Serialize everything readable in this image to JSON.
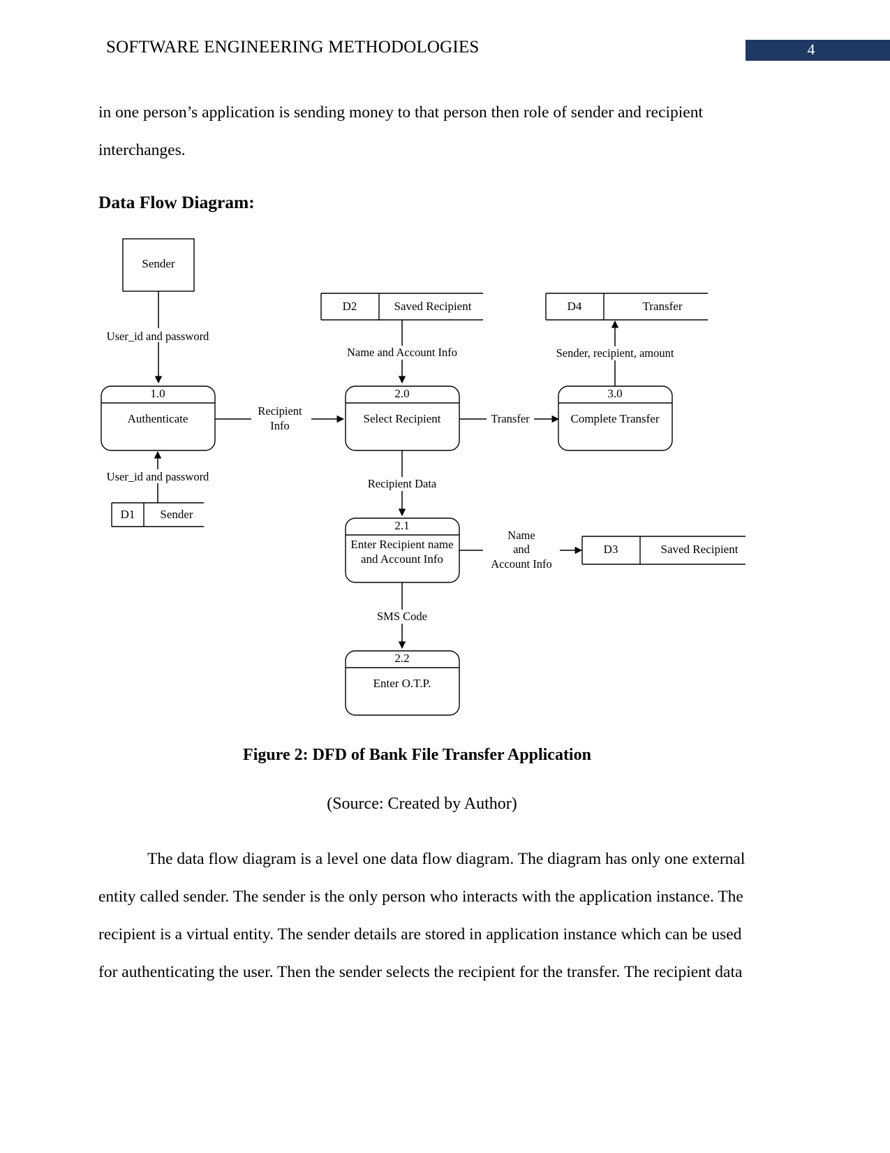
{
  "header": {
    "title": "SOFTWARE ENGINEERING METHODOLOGIES",
    "page_number": "4",
    "accent_color": "#1F3864"
  },
  "body": {
    "paragraph_intro_line1": "in one person’s application is sending money to that person then role of sender and recipient",
    "paragraph_intro_line2": "interchanges.",
    "section_heading": "Data Flow Diagram:",
    "figure_caption": "Figure 2: DFD of Bank File Transfer Application",
    "figure_source": "(Source: Created by Author)",
    "paragraph_desc_line1": "The data flow diagram is a level one data flow diagram. The diagram has only one external",
    "paragraph_desc_line2": "entity called sender. The sender is the only person who interacts with the application instance. The",
    "paragraph_desc_line3": "recipient is a virtual entity. The sender details are stored in application instance which can be used",
    "paragraph_desc_line4": "for authenticating the user. Then the sender selects the recipient for the transfer. The recipient data"
  },
  "diagram": {
    "title": "DFD of Bank File Transfer Application",
    "external_entities": [
      {
        "id": "sender",
        "label": "Sender"
      }
    ],
    "processes": [
      {
        "id": "p1",
        "number": "1.0",
        "label": "Authenticate"
      },
      {
        "id": "p2",
        "number": "2.0",
        "label": "Select Recipient"
      },
      {
        "id": "p3",
        "number": "3.0",
        "label": "Complete Transfer"
      },
      {
        "id": "p21",
        "number": "2.1",
        "label_line1": "Enter Recipient name",
        "label_line2": "and Account Info"
      },
      {
        "id": "p22",
        "number": "2.2",
        "label": "Enter O.T.P."
      }
    ],
    "data_stores": [
      {
        "id": "D1",
        "code": "D1",
        "label": "Sender"
      },
      {
        "id": "D2",
        "code": "D2",
        "label": "Saved Recipient"
      },
      {
        "id": "D3",
        "code": "D3",
        "label": "Saved Recipient"
      },
      {
        "id": "D4",
        "code": "D4",
        "label": "Transfer"
      }
    ],
    "flows": [
      {
        "id": "f1",
        "label": "User_id and password",
        "from": "sender",
        "to": "p1"
      },
      {
        "id": "f2",
        "label": "User_id and password",
        "from": "D1",
        "to": "p1"
      },
      {
        "id": "f3",
        "label_line1": "Recipient",
        "label_line2": "Info",
        "from": "p1",
        "to": "p2"
      },
      {
        "id": "f4",
        "label": "Name and Account Info",
        "from": "D2",
        "to": "p2"
      },
      {
        "id": "f5",
        "label": "Transfer",
        "from": "p2",
        "to": "p3"
      },
      {
        "id": "f6",
        "label": "Sender, recipient, amount",
        "from": "p3",
        "to": "D4"
      },
      {
        "id": "f7",
        "label": "Recipient Data",
        "from": "p2",
        "to": "p21"
      },
      {
        "id": "f8",
        "label_line1": "Name",
        "label_line2": "and",
        "label_line3": "Account Info",
        "from": "p21",
        "to": "D3"
      },
      {
        "id": "f9",
        "label": "SMS Code",
        "from": "p21",
        "to": "p22"
      }
    ]
  }
}
